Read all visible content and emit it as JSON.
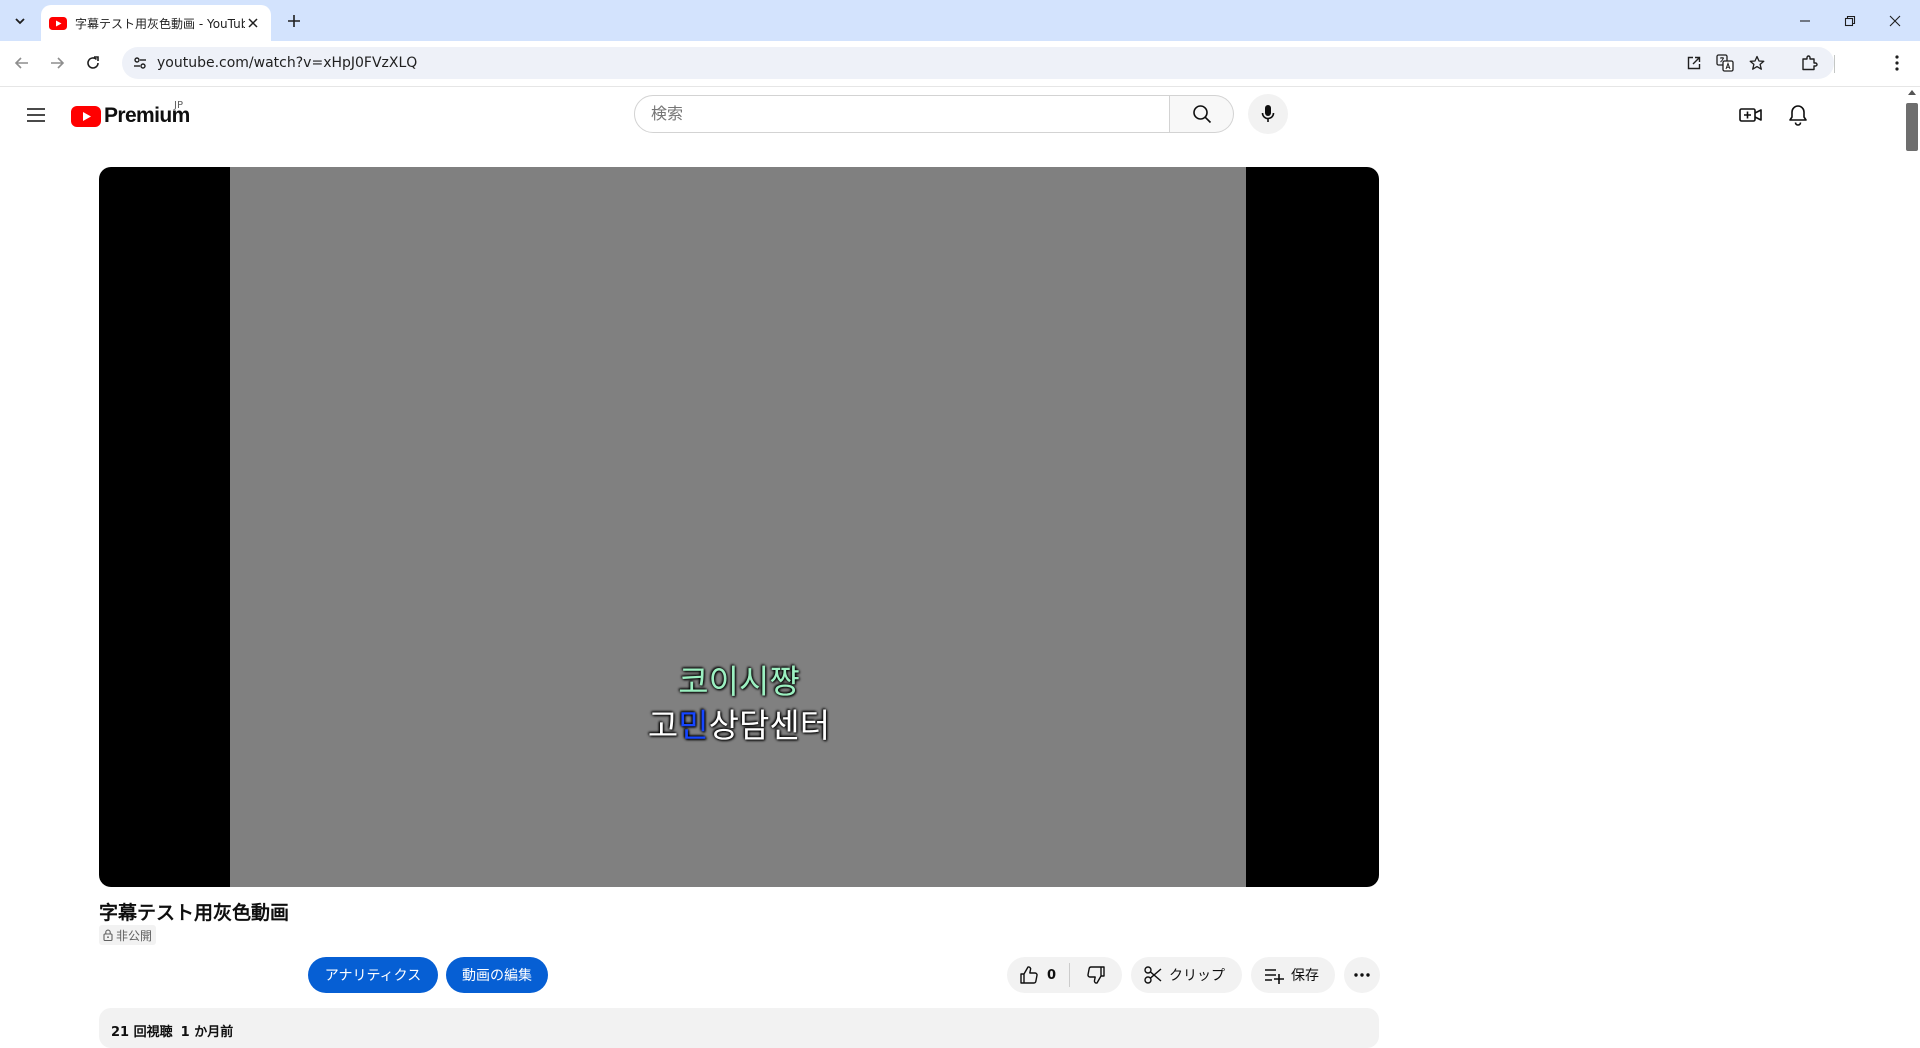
{
  "browser": {
    "tab": {
      "title": "字幕テスト用灰色動画 - YouTube"
    },
    "url": "youtube.com/watch?v=xHpJ0FVzXLQ"
  },
  "masthead": {
    "logo_text": "Premium",
    "country_code": "JP",
    "search_placeholder": "検索"
  },
  "player": {
    "captions": {
      "line1": "코이시쨩",
      "line2_before": "고",
      "line2_highlight": "민",
      "line2_after": "상담센터"
    }
  },
  "video": {
    "title": "字幕テスト用灰色動画",
    "privacy": "非公開",
    "analytics_label": "アナリティクス",
    "edit_label": "動画の編集",
    "like_count": "0",
    "clip_label": "クリップ",
    "save_label": "保存",
    "views": "21 回視聴",
    "date": "1 か月前"
  },
  "colors": {
    "accent": "#065fd4",
    "youtube_red": "#ff0000",
    "caption_green": "#9cf0c1",
    "caption_blue": "#1646ff"
  }
}
